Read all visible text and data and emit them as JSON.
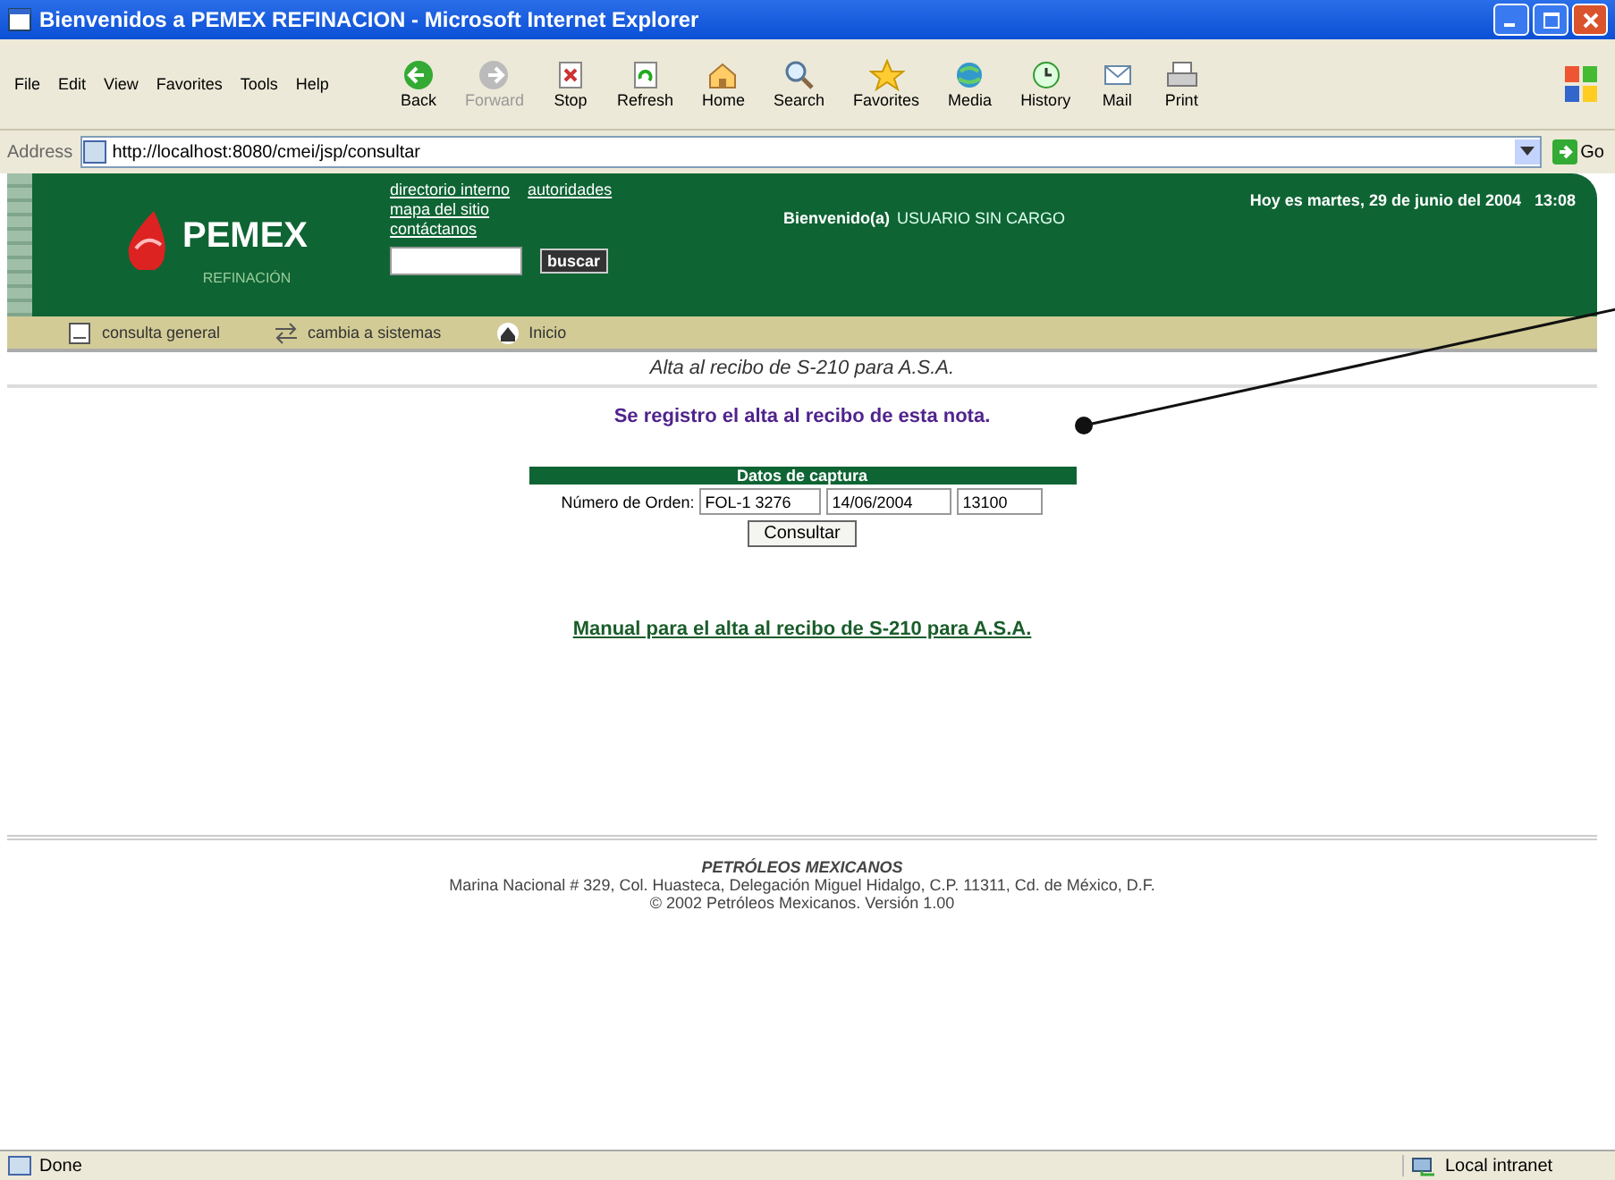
{
  "window": {
    "title": "Bienvenidos a PEMEX REFINACION - Microsoft Internet Explorer"
  },
  "menu": [
    "File",
    "Edit",
    "View",
    "Favorites",
    "Tools",
    "Help"
  ],
  "toolbar": [
    {
      "kind": "back",
      "label": "Back",
      "disabled": false
    },
    {
      "kind": "forward",
      "label": "Forward",
      "disabled": true
    },
    {
      "kind": "stop",
      "label": "Stop",
      "disabled": false
    },
    {
      "kind": "refresh",
      "label": "Refresh",
      "disabled": false
    },
    {
      "kind": "home",
      "label": "Home",
      "disabled": false
    },
    {
      "kind": "search",
      "label": "Search",
      "disabled": false
    },
    {
      "kind": "favorites",
      "label": "Favorites",
      "disabled": false
    },
    {
      "kind": "media",
      "label": "Media",
      "disabled": false
    },
    {
      "kind": "history",
      "label": "History",
      "disabled": false
    },
    {
      "kind": "mail",
      "label": "Mail",
      "disabled": false
    },
    {
      "kind": "print",
      "label": "Print",
      "disabled": false
    }
  ],
  "address": {
    "label": "Address",
    "value": "http://localhost:8080/cmei/jsp/consultar",
    "go": "Go"
  },
  "header": {
    "logo": "PEMEX",
    "subtitle": "REFINACIÓN",
    "links": [
      "directorio interno",
      "autoridades",
      "mapa del sitio",
      "contáctanos"
    ],
    "search_button": "buscar",
    "welcome": "Bienvenido(a)",
    "user": "USUARIO SIN CARGO",
    "date": "Hoy es martes, 29 de junio del 2004   13:08"
  },
  "nav": [
    {
      "kind": "page",
      "label": "consulta general"
    },
    {
      "kind": "swap",
      "label": "cambia a sistemas"
    },
    {
      "kind": "home",
      "label": "Inicio"
    }
  ],
  "page": {
    "heading": "Alta al recibo de S-210 para A.S.A.",
    "message": "Se registro el alta al recibo de esta nota.",
    "form": {
      "title": "Datos de captura",
      "label": "Número de Orden:",
      "fields": [
        "FOL-1 3276",
        "14/06/2004",
        "13100"
      ],
      "button": "Consultar"
    },
    "manual_link": "Manual para el alta al recibo de S-210 para A.S.A."
  },
  "footer": [
    "PETRÓLEOS MEXICANOS",
    "Marina Nacional # 329, Col. Huasteca, Delegación Miguel Hidalgo, C.P. 11311, Cd. de México, D.F.",
    "© 2002 Petróleos Mexicanos. Versión 1.00"
  ],
  "status_bar": {
    "text": "Done",
    "zone": "Local intranet"
  }
}
